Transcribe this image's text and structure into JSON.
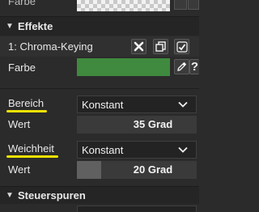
{
  "top_row": {
    "label": "Farbe"
  },
  "effects_section": {
    "title": "Effekte"
  },
  "effect": {
    "name": "1: Chroma-Keying"
  },
  "color_row": {
    "label": "Farbe",
    "color": "#3f8a3f"
  },
  "range": {
    "label": "Bereich",
    "mode": "Konstant",
    "value_label": "Wert",
    "value": "35 Grad",
    "fill_fraction": 0.0
  },
  "softness": {
    "label": "Weichheit",
    "mode": "Konstant",
    "value_label": "Wert",
    "value": "20 Grad",
    "fill_fraction": 0.2
  },
  "tracks_section": {
    "title": "Steuerspuren"
  },
  "colors": {
    "highlight": "#f1e200",
    "swatch_green": "#3f8a3f"
  }
}
